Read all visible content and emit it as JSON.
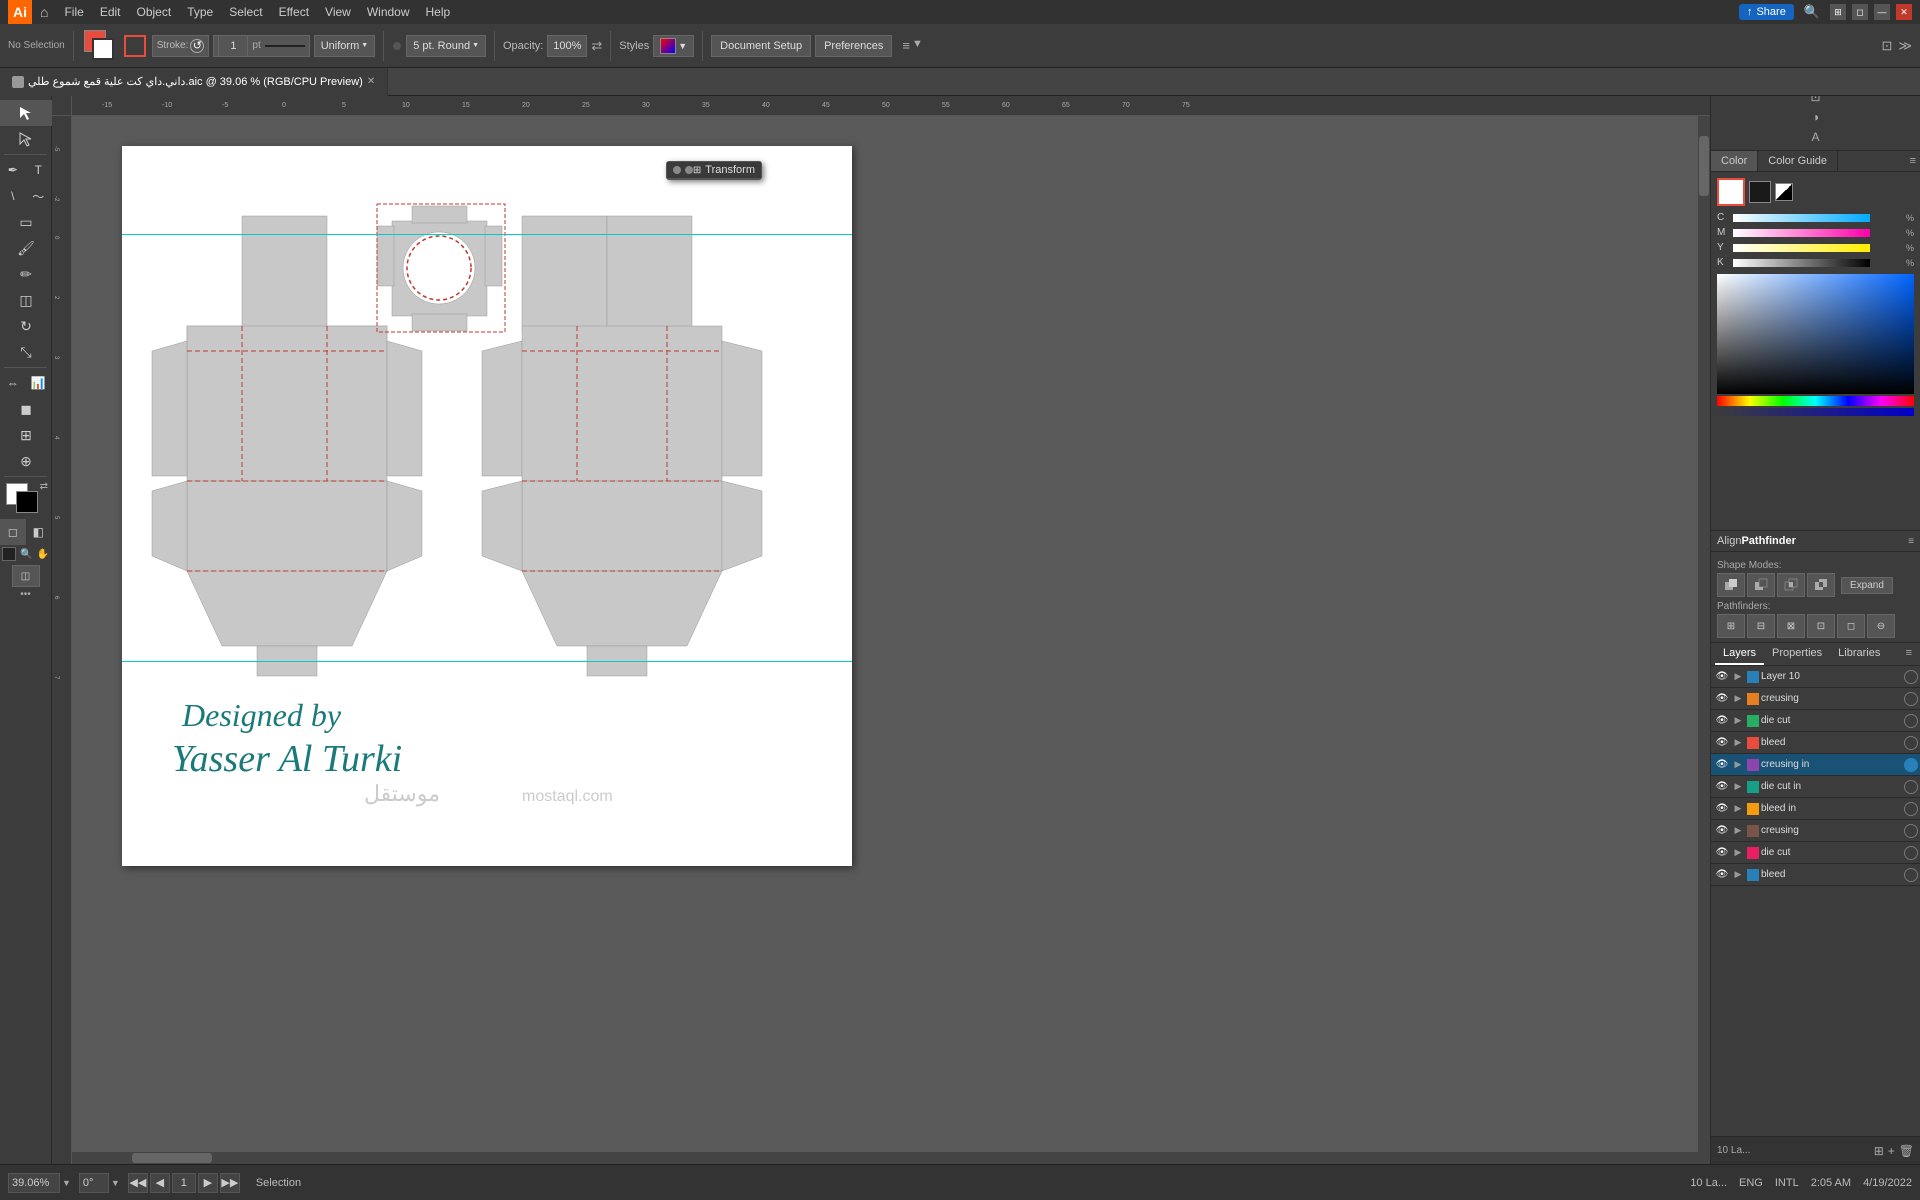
{
  "app": {
    "title": "Adobe Illustrator",
    "logo": "Ai"
  },
  "menu": {
    "items": [
      "File",
      "Edit",
      "Object",
      "Type",
      "Select",
      "Effect",
      "View",
      "Window",
      "Help"
    ]
  },
  "toolbar": {
    "no_selection": "No Selection",
    "stroke_label": "Stroke:",
    "stroke_width": "1",
    "stroke_unit": "pt",
    "stroke_style": "Uniform",
    "pt_round": "5 pt. Round",
    "opacity_label": "Opacity:",
    "opacity_value": "100%",
    "styles_label": "Styles",
    "doc_setup": "Document Setup",
    "preferences": "Preferences"
  },
  "tab": {
    "filename": "داني.داي كت علية قمع شموع طلي.aic @ 39.06 % (RGB/CPU Preview)",
    "shortname": "داني..."
  },
  "transform_panel": {
    "title": "Transform"
  },
  "color_panel": {
    "tab1": "Color",
    "tab2": "Color Guide",
    "cmyk": {
      "c": {
        "label": "C",
        "value": ""
      },
      "m": {
        "label": "M",
        "value": ""
      },
      "y": {
        "label": "Y",
        "value": ""
      },
      "k": {
        "label": "K",
        "value": ""
      }
    }
  },
  "pathfinder": {
    "title": "Align",
    "title2": "Pathfinder",
    "shape_modes": "Shape Modes:",
    "pathfinders": "Pathfinders:",
    "expand": "Expand"
  },
  "layers": {
    "tab1": "Layers",
    "tab2": "Properties",
    "tab3": "Libraries",
    "items": [
      {
        "name": "Layer 10",
        "color": "blue",
        "active": false,
        "visible": true
      },
      {
        "name": "creusing",
        "color": "orange",
        "active": false,
        "visible": true
      },
      {
        "name": "die cut",
        "color": "green",
        "active": false,
        "visible": true
      },
      {
        "name": "bleed",
        "color": "red",
        "active": false,
        "visible": true
      },
      {
        "name": "creusing in",
        "color": "purple",
        "active": true,
        "visible": true
      },
      {
        "name": "die cut in",
        "color": "teal",
        "active": false,
        "visible": true
      },
      {
        "name": "bleed in",
        "color": "yellow",
        "active": false,
        "visible": true
      },
      {
        "name": "creusing",
        "color": "brown",
        "active": false,
        "visible": true
      },
      {
        "name": "die cut",
        "color": "pink",
        "active": false,
        "visible": true
      },
      {
        "name": "bleed",
        "color": "blue",
        "active": false,
        "visible": true
      }
    ],
    "count": "10 La..."
  },
  "status_bar": {
    "zoom": "39.06%",
    "rotation": "0°",
    "page": "1",
    "tool": "Selection",
    "layers_count": "10 La...",
    "time": "2:05 AM",
    "date": "4/19/2022",
    "lang": "ENG",
    "layout": "INTL"
  },
  "canvas": {
    "designer_line1": "Designed by",
    "designer_line2": "Yasser Al Turki",
    "watermark": "mostaql.com"
  },
  "windows": {
    "share_btn": "Share"
  }
}
